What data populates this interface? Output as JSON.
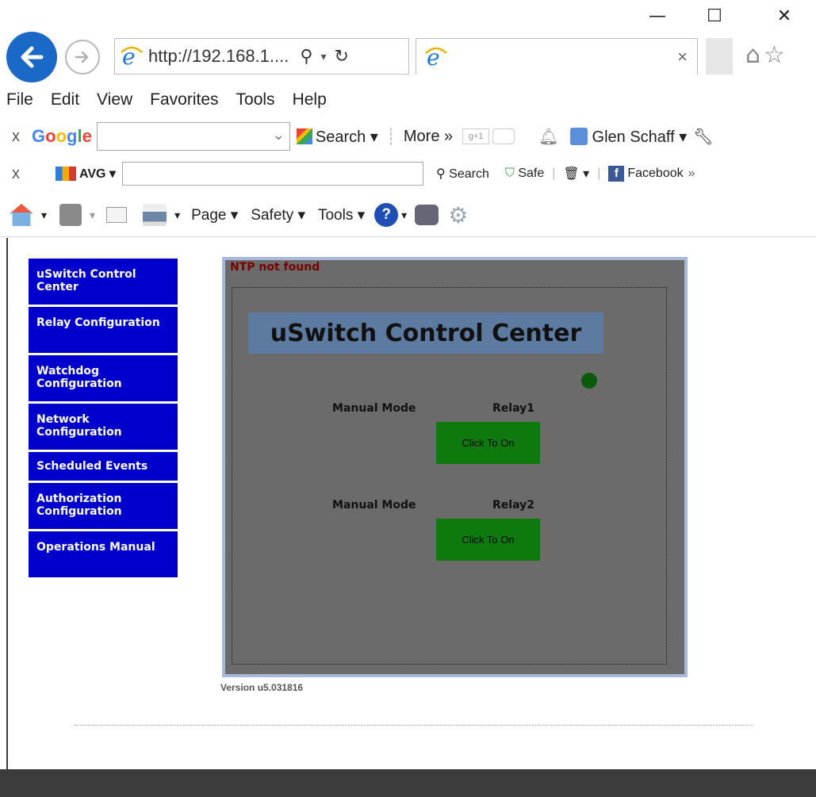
{
  "window": {
    "minimize": "—",
    "maximize": "☐",
    "close": "✕"
  },
  "browser": {
    "address": "http://192.168.1....",
    "tab_title": "",
    "tab_close": "×"
  },
  "menu": [
    "File",
    "Edit",
    "View",
    "Favorites",
    "Tools",
    "Help"
  ],
  "google_toolbar": {
    "close": "x",
    "logo": "Google",
    "search_label": "Search ▾",
    "more_label": "More »",
    "user": "Glen Schaff ▾"
  },
  "avg_toolbar": {
    "close": "x",
    "logo": "AVG ▾",
    "search_label": "Search",
    "safe_label": "Safe",
    "facebook_label": "Facebook"
  },
  "command_bar": {
    "page_label": "Page ▾",
    "safety_label": "Safety ▾",
    "tools_label": "Tools ▾"
  },
  "sidebar": {
    "items": [
      {
        "label": "uSwitch Control Center"
      },
      {
        "label": "Relay Configuration"
      },
      {
        "label": "Watchdog Configuration"
      },
      {
        "label": "Network Configuration"
      },
      {
        "label": "Scheduled Events"
      },
      {
        "label": "Authorization Configuration"
      },
      {
        "label": "Operations Manual"
      }
    ]
  },
  "control_panel": {
    "ntp_status": "NTP not found",
    "title": "uSwitch Control Center",
    "relays": [
      {
        "mode": "Manual Mode",
        "name": "Relay1",
        "button": "Click To On"
      },
      {
        "mode": "Manual Mode",
        "name": "Relay2",
        "button": "Click To On"
      }
    ]
  },
  "version": "Version u5.031816",
  "colors": {
    "sidebar_bg": "#0000cc",
    "panel_bg": "#6b6b6b",
    "title_bg": "#5d7ba0",
    "relay_button": "#0e7a0e",
    "status_dot": "#0c5a0c",
    "ntp_text": "#7a0000"
  }
}
